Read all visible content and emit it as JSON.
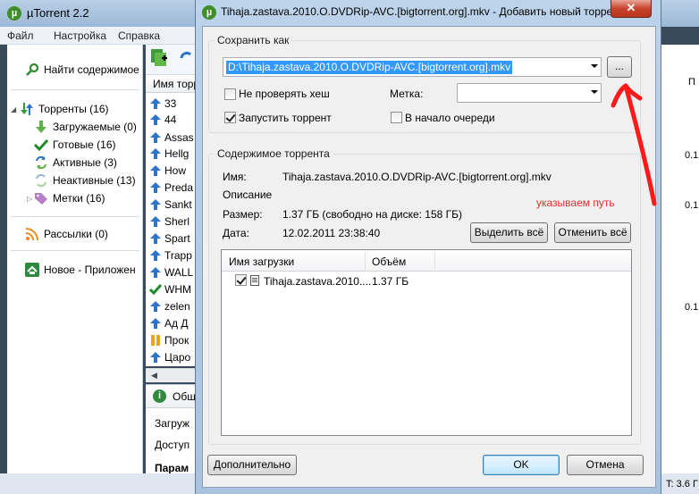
{
  "app": {
    "title": "µTorrent 2.2",
    "menu": [
      "Файл",
      "Настройка",
      "Справка"
    ],
    "sidebar": {
      "search_label": "Найти содержимое",
      "torrents": "Торренты (16)",
      "downloading": "Загружаемые (0)",
      "completed": "Готовые (16)",
      "active": "Активные (3)",
      "inactive": "Неактивные (13)",
      "labels": "Метки (16)",
      "feeds": "Рассылки (0)",
      "apps": "Новое - Приложен"
    },
    "list_header": "Имя торр",
    "torrents": [
      "33",
      "44",
      "Assas",
      "Hellg",
      "How",
      "Preda",
      "Sankt",
      "Sherl",
      "Spart",
      "Trapp",
      "WALL",
      "WHM",
      "zelen",
      "Ад Д",
      "Прок",
      "Царо"
    ],
    "details_tab": "Общ",
    "details_rows": [
      "Загруж",
      "Доступ",
      "Парам"
    ],
    "right_values": [
      "П",
      "0.1",
      "0.1",
      "0.1"
    ],
    "status_right": "T: 3.6 Г"
  },
  "dialog": {
    "title": "Tihaja.zastava.2010.O.DVDRip-AVC.[bigtorrent.org].mkv - Добавить новый торре",
    "close_glyph": "✕",
    "save_as": {
      "group_title": "Сохранить как",
      "path": "D:\\Tihaja.zastava.2010.O.DVDRip-AVC.[bigtorrent.org].mkv",
      "browse_label": "...",
      "skip_hash_label": "Не проверять хеш",
      "skip_hash_checked": false,
      "label_caption": "Метка:",
      "label_value": "",
      "start_torrent_label": "Запустить торрент",
      "start_torrent_checked": true,
      "queue_top_label": "В начало очереди",
      "queue_top_checked": false
    },
    "content": {
      "group_title": "Содержимое торрента",
      "name_caption": "Имя:",
      "name_value": "Tihaja.zastava.2010.O.DVDRip-AVC.[bigtorrent.org].mkv",
      "description_caption": "Описание",
      "size_caption": "Размер:",
      "size_value": "1.37 ГБ (свободно на диске: 158 ГБ)",
      "date_caption": "Дата:",
      "date_value": "12.02.2011 23:38:40",
      "select_all_label": "Выделить всё",
      "deselect_all_label": "Отменить всё",
      "columns": [
        "Имя загрузки",
        "Объём"
      ],
      "files": [
        {
          "name": "Tihaja.zastava.2010....",
          "size": "1.37 ГБ",
          "checked": true
        }
      ]
    },
    "buttons": {
      "advanced": "Дополнительно",
      "ok": "OK",
      "cancel": "Отмена"
    },
    "annotation": {
      "text": "указываем путь",
      "color": "#e0332a"
    }
  },
  "colors": {
    "accent": "#3399ff",
    "titlebar": "#bcd3ea",
    "annotation_red": "#ff1a1a"
  }
}
